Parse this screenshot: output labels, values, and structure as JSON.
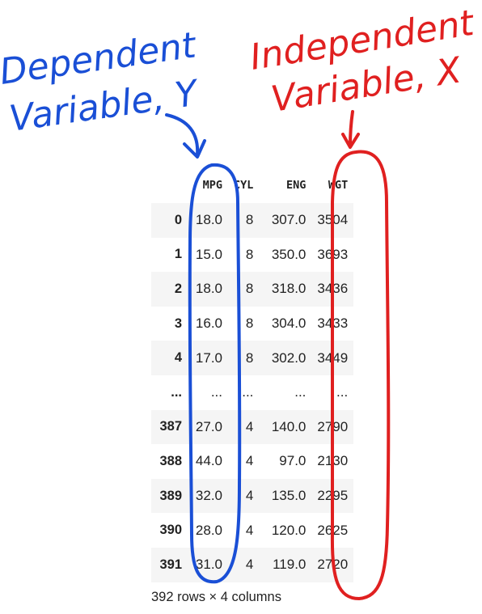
{
  "annotations": {
    "dependent": {
      "line1": "Dependent",
      "line2": "Variable, Y",
      "color": "#1a4fd6"
    },
    "independent": {
      "line1": "Independent",
      "line2": "Variable, X",
      "color": "#e02020"
    }
  },
  "table": {
    "columns": [
      "MPG",
      "CYL",
      "ENG",
      "WGT"
    ],
    "rows": [
      {
        "index": "0",
        "values": [
          "18.0",
          "8",
          "307.0",
          "3504"
        ]
      },
      {
        "index": "1",
        "values": [
          "15.0",
          "8",
          "350.0",
          "3693"
        ]
      },
      {
        "index": "2",
        "values": [
          "18.0",
          "8",
          "318.0",
          "3436"
        ]
      },
      {
        "index": "3",
        "values": [
          "16.0",
          "8",
          "304.0",
          "3433"
        ]
      },
      {
        "index": "4",
        "values": [
          "17.0",
          "8",
          "302.0",
          "3449"
        ]
      },
      {
        "index": "...",
        "values": [
          "...",
          "...",
          "...",
          "..."
        ]
      },
      {
        "index": "387",
        "values": [
          "27.0",
          "4",
          "140.0",
          "2790"
        ]
      },
      {
        "index": "388",
        "values": [
          "44.0",
          "4",
          "97.0",
          "2130"
        ]
      },
      {
        "index": "389",
        "values": [
          "32.0",
          "4",
          "135.0",
          "2295"
        ]
      },
      {
        "index": "390",
        "values": [
          "28.0",
          "4",
          "120.0",
          "2625"
        ]
      },
      {
        "index": "391",
        "values": [
          "31.0",
          "4",
          "119.0",
          "2720"
        ]
      }
    ],
    "footer": "392 rows × 4 columns"
  }
}
